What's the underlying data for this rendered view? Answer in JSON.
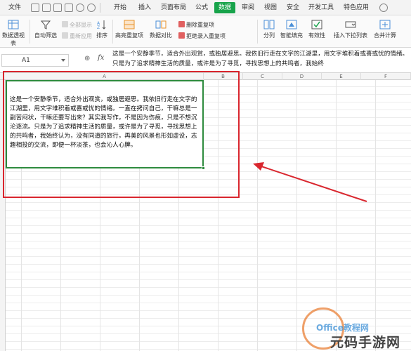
{
  "menubar": {
    "items": [
      "文件",
      "开始",
      "插入",
      "页面布局",
      "公式",
      "数据",
      "审阅",
      "视图",
      "安全",
      "开发工具",
      "特色应用"
    ],
    "active_item": "数据",
    "accent_color": "#17a34a"
  },
  "ribbon": {
    "pivot_label": "数据透视表",
    "autofilter_label": "自动筛选",
    "show_all_label": "全部显示",
    "reapply_label": "重新应用",
    "sort_label": "排序",
    "highlight_duplicates_label": "高亮重复项",
    "data_compare_label": "数据对比",
    "delete_duplicates_label": "删除重复项",
    "reject_duplicates_label": "拒绝录入重复项",
    "split_label": "分列",
    "smart_fill_label": "智能填充",
    "validity_label": "有效性",
    "insert_dropdown_label": "插入下拉列表",
    "consolidate_label": "合并计算"
  },
  "formula_bar": {
    "name_box": "A1",
    "fx_label": "fx",
    "content": "这是一个安静季节，适合外出观赏，或独居避思。我依旧行走在文字的江湖里，用文字堆积着或喜或忧的情绪。只是为了追求精神生活的质量，或许是为了寻觅，寻找思想上的共鸣者，我始终"
  },
  "grid": {
    "columns": [
      "A",
      "B",
      "C",
      "D",
      "E",
      "F"
    ],
    "cell_a1_text": "这是一个安静季节，适合外出观赏，或独居避思。我依旧行走在文字的江湖里，用文字堆积着或喜或忧的情绪。一直在拷问自己，干嘛总是一副苦闷状，干嘛还要写出来？其实我写作，不是因为伤痕，只是不想沉沦逐流。只是为了追求精神生活的质量，或许是为了寻觅，寻找思想上的共鸣者，我始终认为，没有同道的旅行，再美的风景也形如虚设，志趣相投的交流，即便一杯淡茶，也会沁人心脾。",
    "selection_color": "#2e8b3e"
  },
  "annotation": {
    "box_color": "#d9262e"
  },
  "watermark": {
    "office_text": "Office教程网",
    "site_text": "元码手游网"
  }
}
